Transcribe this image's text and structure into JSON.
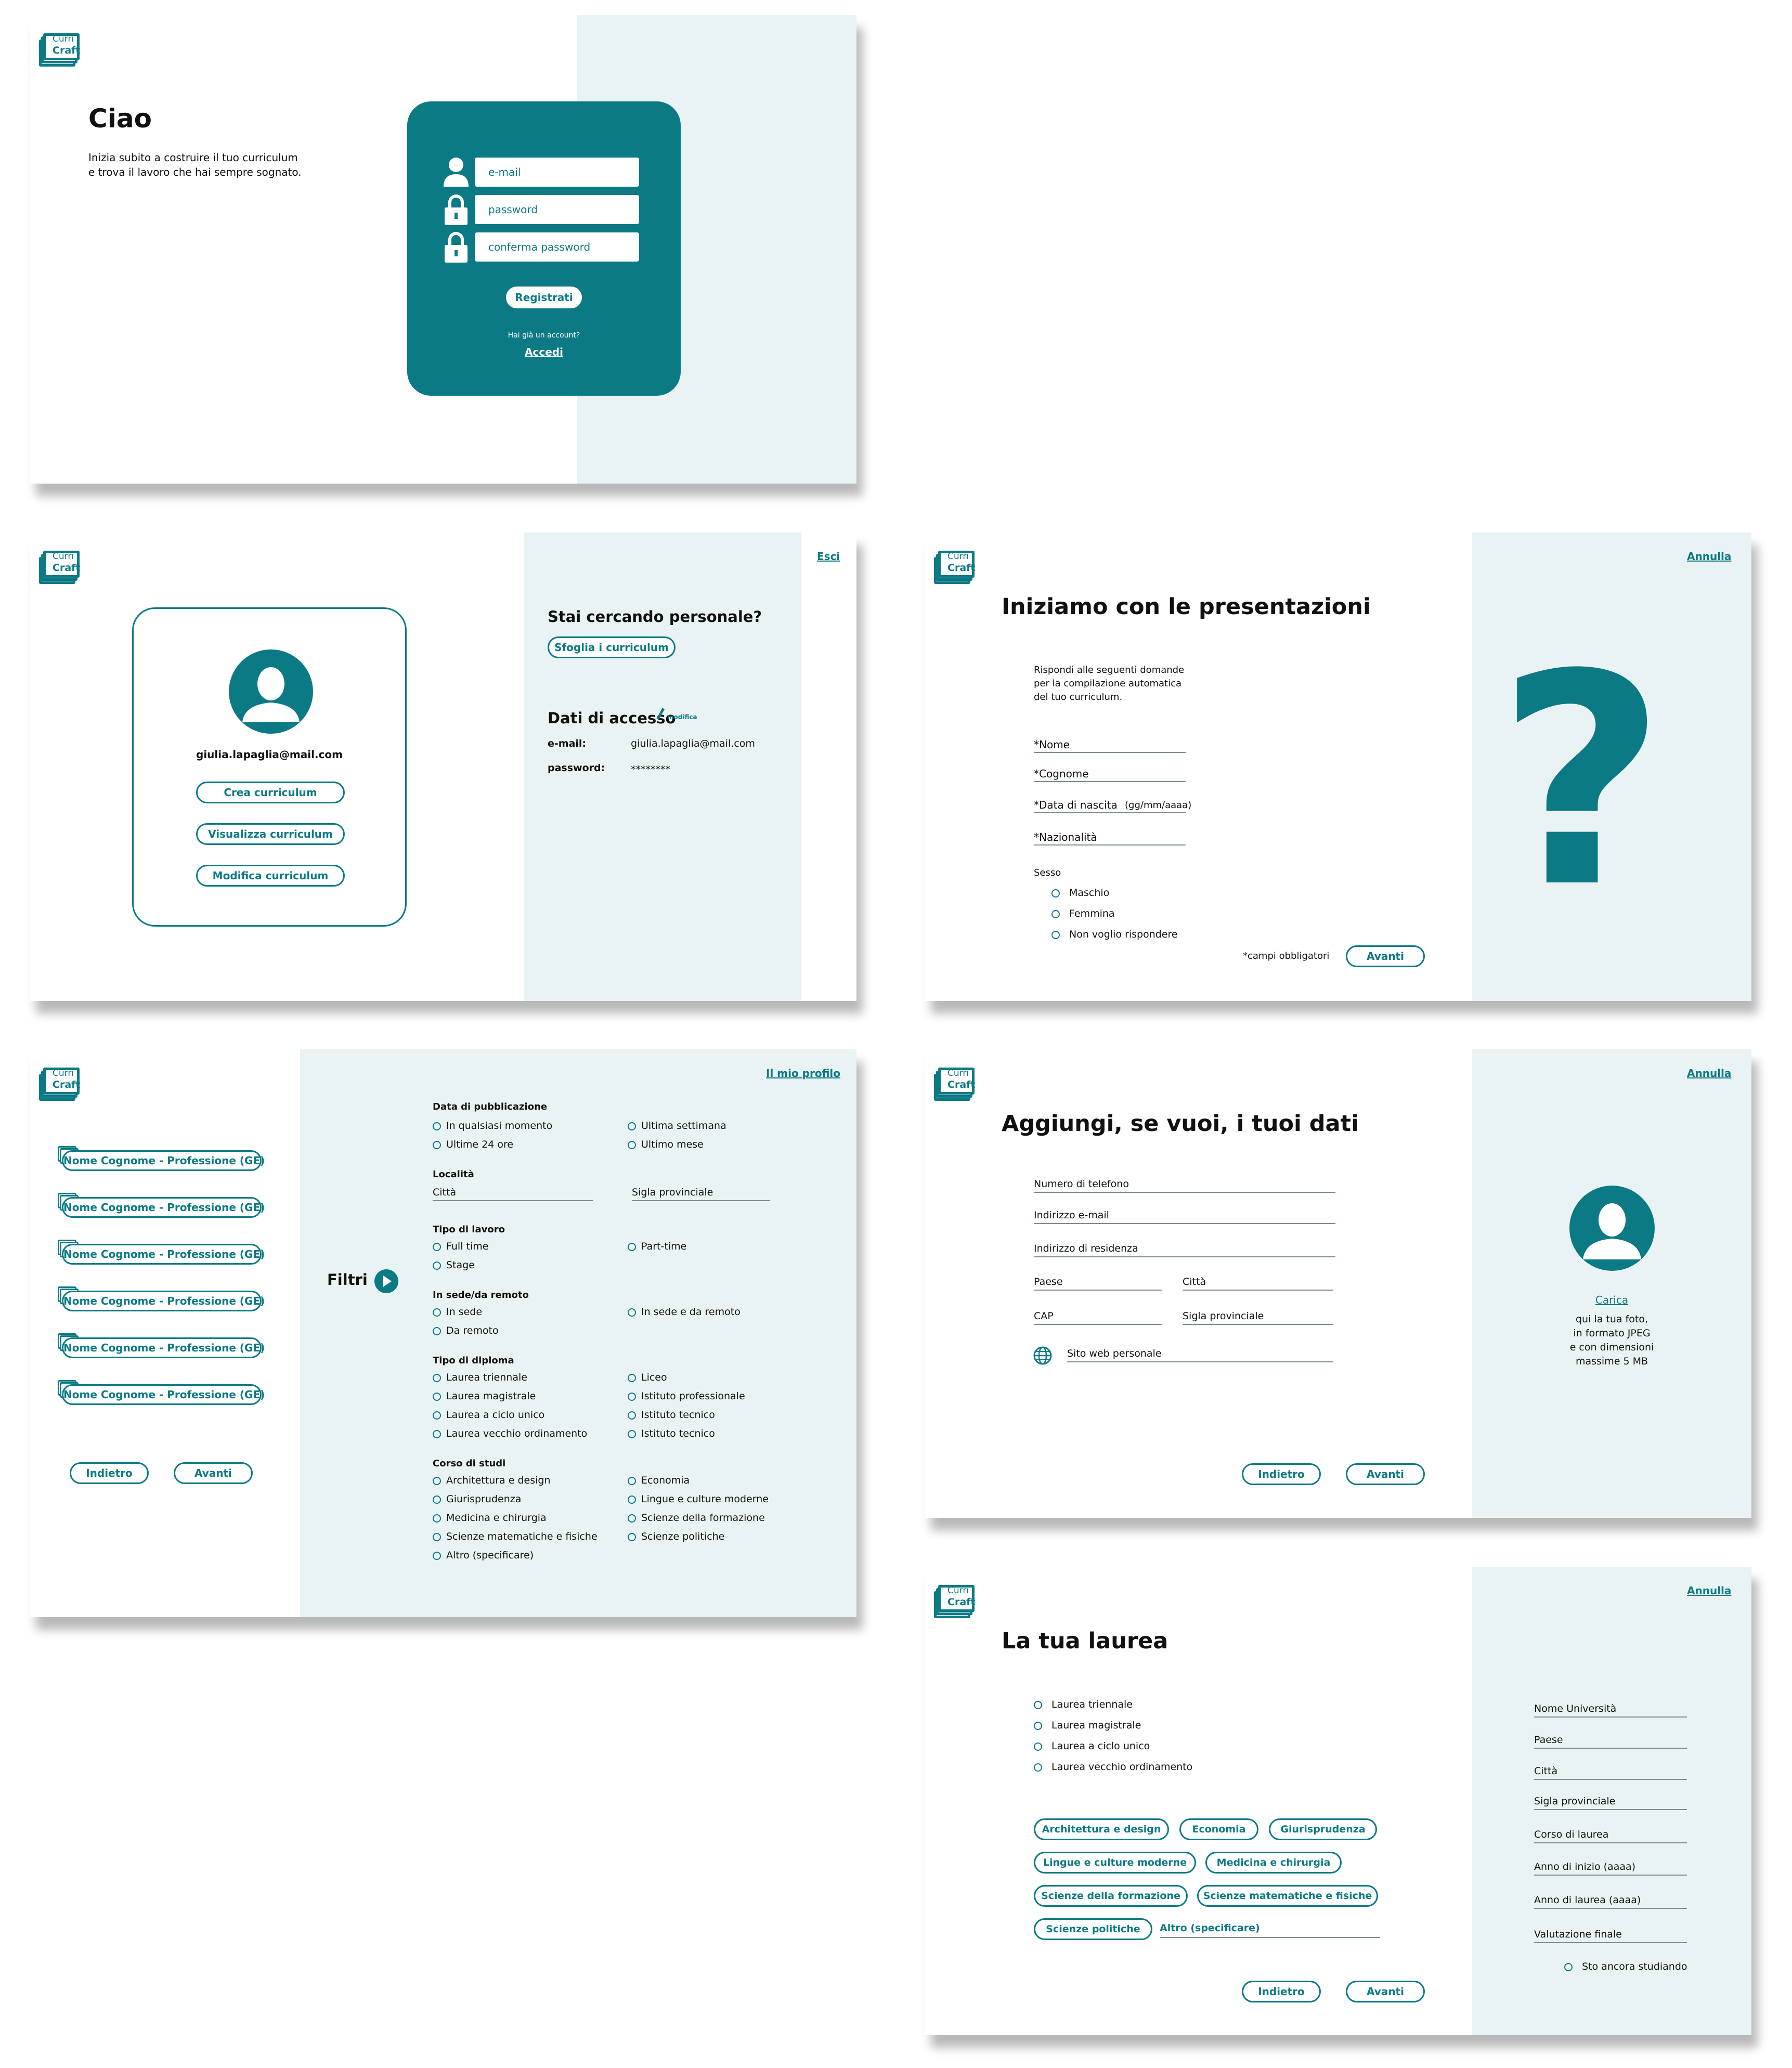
{
  "brand": {
    "line1": "Curri",
    "line2": "Craft"
  },
  "s1": {
    "title": "Ciao",
    "subtitle1": "Inizia subito a costruire il tuo curriculum",
    "subtitle2": "e trova il lavoro che hai sempre sognato.",
    "email_placeholder": "e-mail",
    "password_placeholder": "password",
    "confirm_placeholder": "conferma password",
    "register": "Registrati",
    "have_account": "Hai già un account?",
    "login": "Accedi"
  },
  "s2": {
    "logout": "Esci",
    "email": "giulia.lapaglia@mail.com",
    "create": "Crea curriculum",
    "view": "Visualizza curriculum",
    "edit": "Modifica curriculum",
    "searching": "Stai cercando personale?",
    "browse": "Sfoglia i curriculum",
    "access_title": "Dati di accesso",
    "modify": "modifica",
    "email_label": "e-mail:",
    "email_value": "giulia.lapaglia@mail.com",
    "password_label": "password:",
    "password_value": "********"
  },
  "s3": {
    "cancel": "Annulla",
    "title": "Iniziamo con le presentazioni",
    "intro": [
      "Rispondi alle seguenti domande",
      "per la compilazione automatica",
      "del tuo curriculum."
    ],
    "name": "*Nome",
    "surname": "*Cognome",
    "dob": "*Data di nascita",
    "dob_hint": "(gg/mm/aaaa)",
    "nationality": "*Nazionalità",
    "sex": "Sesso",
    "male": "Maschio",
    "female": "Femmina",
    "none": "Non voglio rispondere",
    "required": "*campi obbligatori",
    "next": "Avanti",
    "qmark": "?"
  },
  "s4": {
    "profile": "Il mio profilo",
    "cv_items": [
      "Nome Cognome - Professione (GE)",
      "Nome Cognome - Professione (GE)",
      "Nome Cognome - Professione (GE)",
      "Nome Cognome - Professione (GE)",
      "Nome Cognome - Professione (GE)",
      "Nome Cognome - Professione (GE)"
    ],
    "back": "Indietro",
    "next": "Avanti",
    "filters": "Filtri",
    "pub": "Data di pubblicazione",
    "pub_any": "In qualsiasi momento",
    "pub_week": "Ultima settimana",
    "pub_24": "Ultime 24 ore",
    "pub_month": "Ultimo mese",
    "loc": "Località",
    "city": "Città",
    "prov": "Sigla provinciale",
    "job": "Tipo di lavoro",
    "full": "Full time",
    "part": "Part-time",
    "stage": "Stage",
    "remote_title": "In sede/da remoto",
    "onsite": "In sede",
    "both": "In sede e da remoto",
    "remote": "Da remoto",
    "diploma": "Tipo di diploma",
    "d1": "Laurea triennale",
    "d2": "Liceo",
    "d3": "Laurea magistrale",
    "d4": "Istituto professionale",
    "d5": "Laurea a ciclo unico",
    "d6": "Istituto tecnico",
    "d7": "Laurea vecchio ordinamento",
    "d8": "Istituto tecnico",
    "course": "Corso di studi",
    "c1": "Architettura e design",
    "c2": "Economia",
    "c3": "Giurisprudenza",
    "c4": "Lingue e culture moderne",
    "c5": "Medicina e chirurgia",
    "c6": "Scienze della formazione",
    "c7": "Scienze matematiche e fisiche",
    "c8": "Scienze politiche",
    "c9": "Altro (specificare)"
  },
  "s5": {
    "cancel": "Annulla",
    "title": "Aggiungi, se vuoi, i tuoi dati",
    "phone": "Numero di telefono",
    "email": "Indirizzo e-mail",
    "address": "Indirizzo di residenza",
    "country": "Paese",
    "city": "Città",
    "cap": "CAP",
    "prov": "Sigla provinciale",
    "web": "Sito web personale",
    "back": "Indietro",
    "next": "Avanti",
    "upload": "Carica",
    "photo_hint": [
      "qui la tua foto,",
      "in formato JPEG",
      "e con dimensioni",
      "massime 5 MB"
    ]
  },
  "s6": {
    "cancel": "Annulla",
    "title": "La tua laurea",
    "r1": "Laurea triennale",
    "r2": "Laurea magistrale",
    "r3": "Laurea a ciclo unico",
    "r4": "Laurea vecchio ordinamento",
    "chips": [
      "Architettura e design",
      "Economia",
      "Giurisprudenza",
      "Lingue e culture moderne",
      "Medicina e chirurgia",
      "Scienze della formazione",
      "Scienze matematiche e fisiche",
      "Scienze politiche"
    ],
    "other": "Altro (specificare)",
    "back": "Indietro",
    "next": "Avanti",
    "uni": "Nome Università",
    "country": "Paese",
    "city": "Città",
    "prov": "Sigla provinciale",
    "course": "Corso di laurea",
    "start": "Anno di inizio (aaaa)",
    "end": "Anno di laurea (aaaa)",
    "grade": "Valutazione finale",
    "studying": "Sto ancora studiando"
  }
}
